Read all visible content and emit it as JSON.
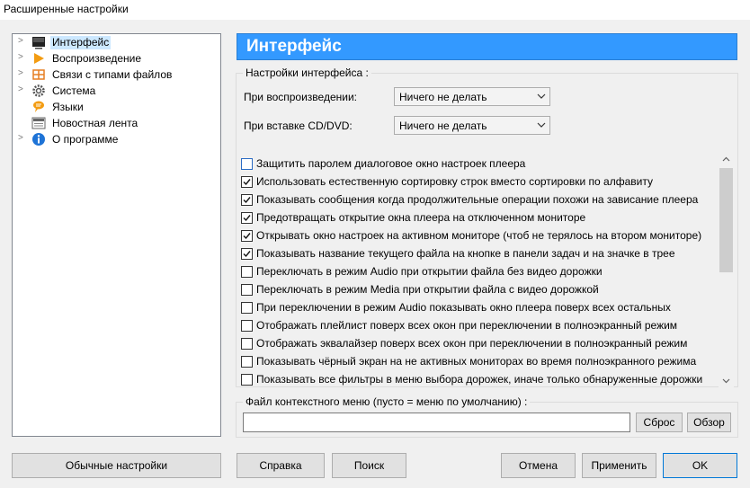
{
  "window": {
    "title": "Расширенные настройки"
  },
  "tree": {
    "items": [
      {
        "label": "Интерфейс",
        "icon": "monitor-icon",
        "expandable": true,
        "selected": true
      },
      {
        "label": "Воспроизведение",
        "icon": "play-icon",
        "expandable": true
      },
      {
        "label": "Связи с типами файлов",
        "icon": "file-assoc-icon",
        "expandable": true
      },
      {
        "label": "Система",
        "icon": "gear-icon",
        "expandable": true
      },
      {
        "label": "Языки",
        "icon": "language-icon",
        "expandable": false
      },
      {
        "label": "Новостная лента",
        "icon": "news-icon",
        "expandable": false
      },
      {
        "label": "О программе",
        "icon": "info-icon",
        "expandable": true
      }
    ]
  },
  "panel": {
    "title": "Интерфейс",
    "group_label": "Настройки интерфейса :",
    "playback_label": "При воспроизведении:",
    "playback_value": "Ничего не делать",
    "cd_label": "При вставке CD/DVD:",
    "cd_value": "Ничего не делать",
    "checkboxes": [
      {
        "label": "Защитить паролем диалоговое окно настроек плеера",
        "checked": false
      },
      {
        "label": "Использовать естественную сортировку строк вместо сортировки по алфавиту",
        "checked": true
      },
      {
        "label": "Показывать сообщения когда продолжительные операции похожи на зависание плеера",
        "checked": true
      },
      {
        "label": "Предотвращать открытие окна плеера на отключенном мониторе",
        "checked": true
      },
      {
        "label": "Открывать окно настроек на активном мониторе (чтоб не терялось на втором мониторе)",
        "checked": true
      },
      {
        "label": "Показывать название текущего файла на кнопке в панели задач и на значке в трее",
        "checked": true
      },
      {
        "label": "Переключать в режим Audio при открытии файла без видео дорожки",
        "checked": false
      },
      {
        "label": "Переключать в режим Media при открытии файла с видео дорожкой",
        "checked": false
      },
      {
        "label": "При переключении в режим Audio показывать окно плеера поверх всех остальных",
        "checked": false
      },
      {
        "label": "Отображать плейлист поверх всех окон при переключении в полноэкранный режим",
        "checked": false
      },
      {
        "label": "Отображать эквалайзер поверх всех окон при переключении в полноэкранный режим",
        "checked": false
      },
      {
        "label": "Показывать чёрный экран на не активных мониторах во время полноэкранного режима",
        "checked": false
      },
      {
        "label": "Показывать все фильтры в меню выбора дорожек, иначе только обнаруженные дорожки",
        "checked": false
      }
    ],
    "context_label": "Файл контекстного меню (пусто = меню по умолчанию) :",
    "context_value": "",
    "reset_label": "Сброс",
    "browse_label": "Обзор"
  },
  "buttons": {
    "basic": "Обычные настройки",
    "help": "Справка",
    "search": "Поиск",
    "cancel": "Отмена",
    "apply": "Применить",
    "ok": "OK"
  },
  "colors": {
    "header_bg": "#3399ff",
    "selection_bg": "#cce8ff",
    "window_bg": "#f0f0f0"
  }
}
